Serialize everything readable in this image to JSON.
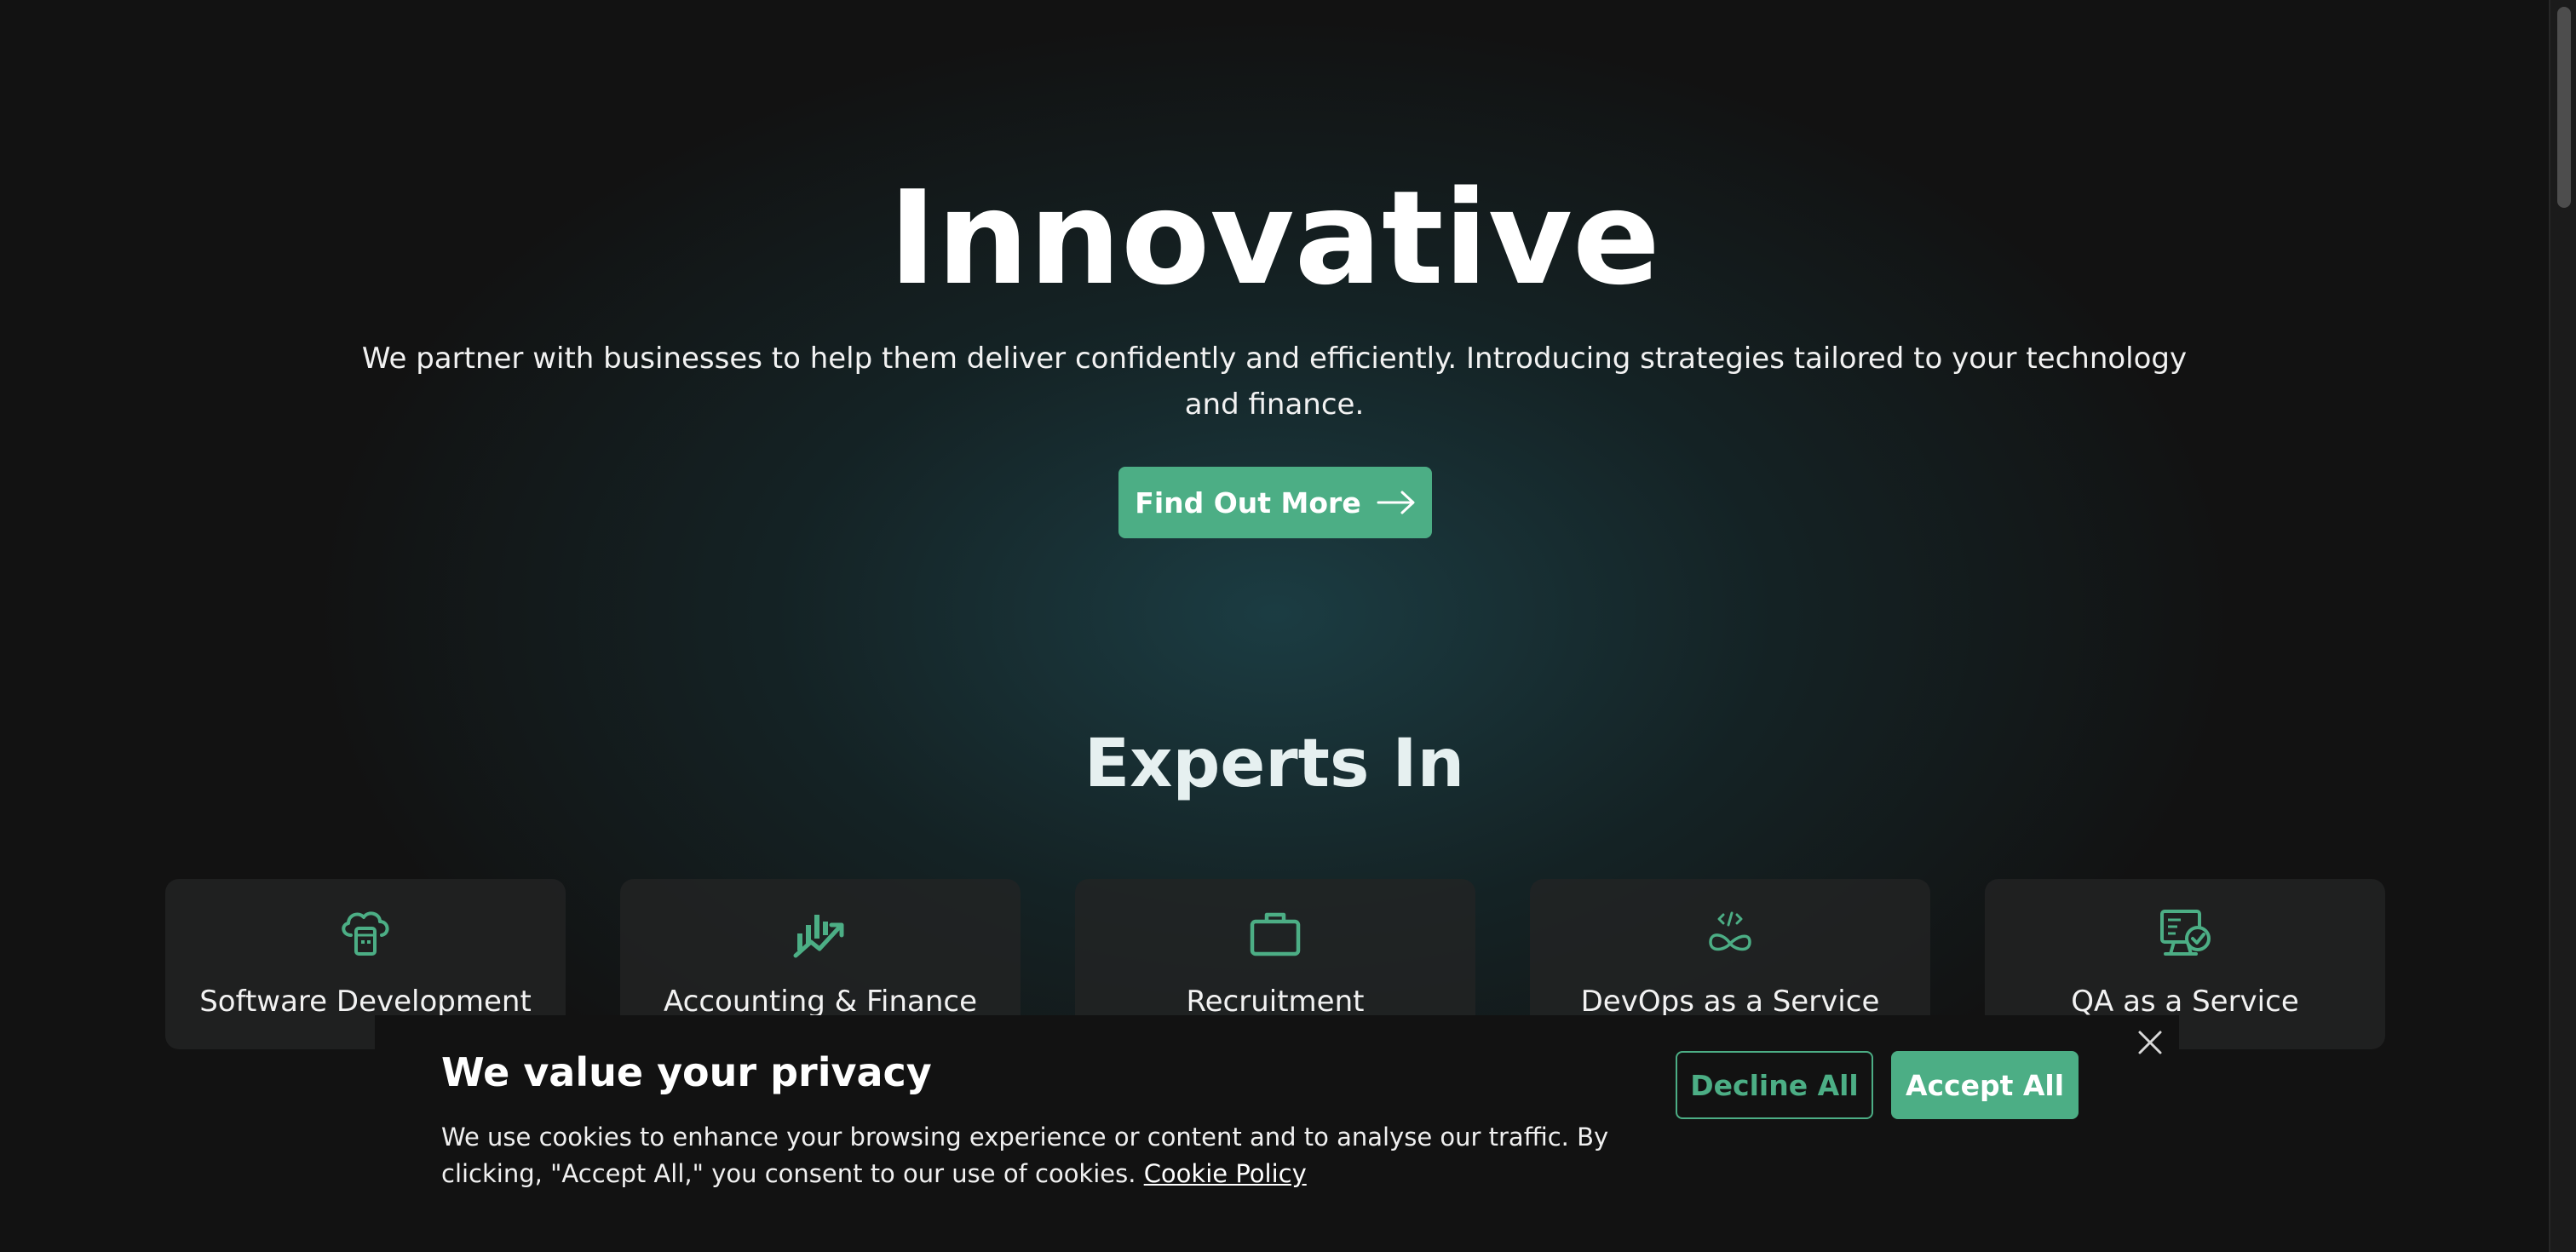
{
  "hero": {
    "title": "Innovative",
    "subtitle": "We partner with businesses to help them deliver confidently and efficiently. Introducing strategies tailored to your technology and finance.",
    "cta_label": "Find Out More",
    "cta_icon": "arrow-right-icon"
  },
  "experts": {
    "title": "Experts In",
    "cards": [
      {
        "label": "Software Development",
        "icon": "cloud-server-icon"
      },
      {
        "label": "Accounting & Finance",
        "icon": "chart-growth-icon"
      },
      {
        "label": "Recruitment",
        "icon": "briefcase-icon"
      },
      {
        "label": "DevOps as a Service",
        "icon": "devops-infinity-icon"
      },
      {
        "label": "QA as a Service",
        "icon": "qa-monitor-check-icon"
      }
    ]
  },
  "cookie_banner": {
    "title": "We value your privacy",
    "text": "We use cookies to enhance your browsing experience or content and to analyse our traffic. By clicking, \"Accept All,\" you consent to our use of cookies.",
    "link_label": "Cookie Policy",
    "decline_label": "Decline All",
    "accept_label": "Accept All",
    "close_icon": "close-icon"
  },
  "colors": {
    "accent": "#4cae85",
    "background": "#121212",
    "card": "#222424"
  }
}
